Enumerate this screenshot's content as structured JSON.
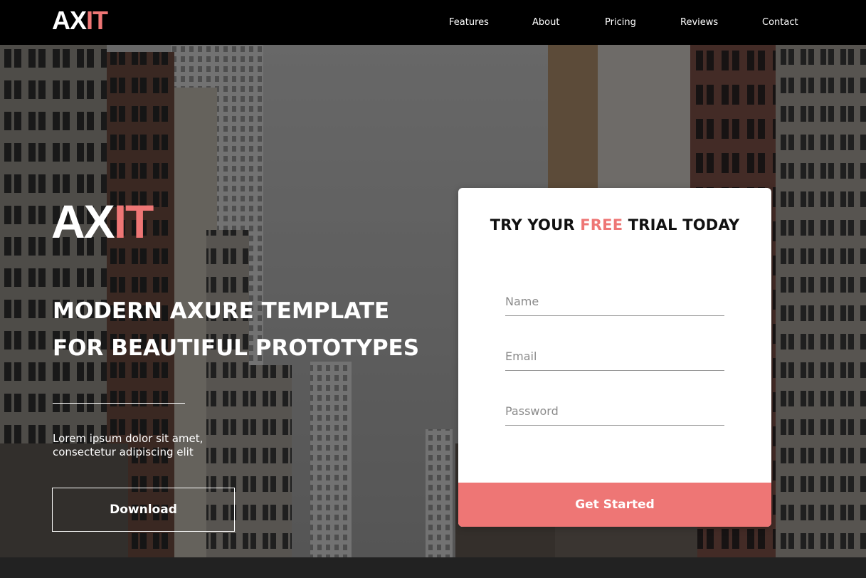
{
  "brand": {
    "name_white": "AX",
    "name_accent": "IT",
    "accent_color": "#ee7675"
  },
  "nav": {
    "items": [
      {
        "label": "Features"
      },
      {
        "label": "About"
      },
      {
        "label": "Pricing"
      },
      {
        "label": "Reviews"
      },
      {
        "label": "Contact"
      }
    ]
  },
  "hero": {
    "headline_line1": "MODERN AXURE TEMPLATE",
    "headline_line2": "FOR BEAUTIFUL PROTOTYPES",
    "lead_line1": "Lorem ipsum dolor sit amet,",
    "lead_line2": "consectetur adipiscing elit",
    "download_label": "Download"
  },
  "signup": {
    "title_part1": "TRY YOUR ",
    "title_free": "FREE",
    "title_part2": " TRIAL TODAY",
    "name_placeholder": "Name",
    "email_placeholder": "Email",
    "password_placeholder": "Password",
    "submit_label": "Get Started"
  }
}
